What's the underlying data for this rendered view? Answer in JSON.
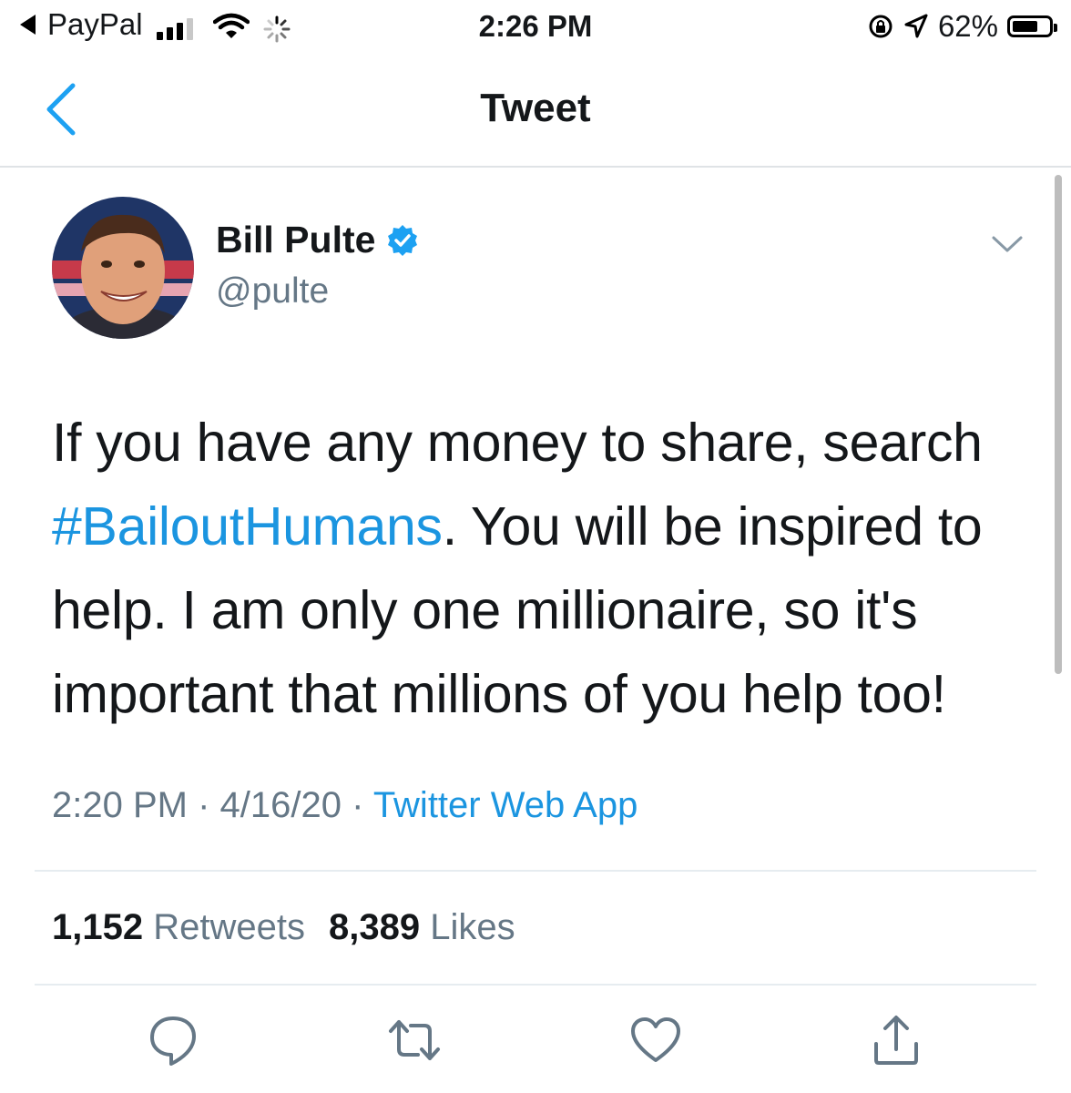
{
  "status_bar": {
    "back_app": "PayPal",
    "time": "2:26 PM",
    "battery_percent": "62%",
    "battery_level": 0.62,
    "signal_bars_active": 3,
    "signal_bars_total": 4
  },
  "nav": {
    "title": "Tweet",
    "back_icon": "chevron-left-icon"
  },
  "tweet": {
    "author": {
      "name": "Bill Pulte",
      "handle": "@pulte",
      "verified": true
    },
    "text": {
      "part1": "If you have any money to share, search ",
      "hashtag": "#BailoutHumans",
      "part2": ".  You will be inspired to help.  I am only one millionaire, so it's important that millions of you help too!"
    },
    "meta": {
      "time": "2:20 PM",
      "sep1": " · ",
      "date": "4/16/20",
      "sep2": " · ",
      "source": "Twitter Web App"
    },
    "stats": {
      "retweets_count": "1,152",
      "retweets_label": "Retweets",
      "likes_count": "8,389",
      "likes_label": "Likes"
    }
  },
  "actions": [
    "reply-icon",
    "retweet-icon",
    "like-icon",
    "share-icon"
  ],
  "colors": {
    "accent": "#1b95e0",
    "text": "#14171a",
    "secondary": "#657786",
    "verified": "#1da1f2"
  }
}
